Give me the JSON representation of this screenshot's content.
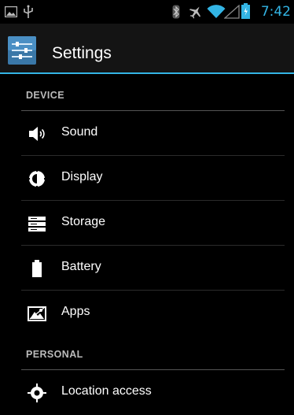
{
  "status_bar": {
    "time": "7:42",
    "icons": [
      "picture-icon",
      "usb-icon",
      "bluetooth-icon",
      "airplane-icon",
      "wifi-icon",
      "signal-icon",
      "battery-icon"
    ]
  },
  "action_bar": {
    "title": "Settings",
    "icon": "settings-app-icon"
  },
  "sections": {
    "device": {
      "label": "DEVICE",
      "items": [
        {
          "label": "Sound",
          "icon": "sound-icon"
        },
        {
          "label": "Display",
          "icon": "display-icon"
        },
        {
          "label": "Storage",
          "icon": "storage-icon"
        },
        {
          "label": "Battery",
          "icon": "battery-icon"
        },
        {
          "label": "Apps",
          "icon": "apps-icon"
        }
      ]
    },
    "personal": {
      "label": "PERSONAL",
      "items": [
        {
          "label": "Location access",
          "icon": "location-icon"
        }
      ]
    }
  },
  "colors": {
    "accent": "#33b5e5",
    "background": "#000000",
    "action_bar": "#141414"
  }
}
